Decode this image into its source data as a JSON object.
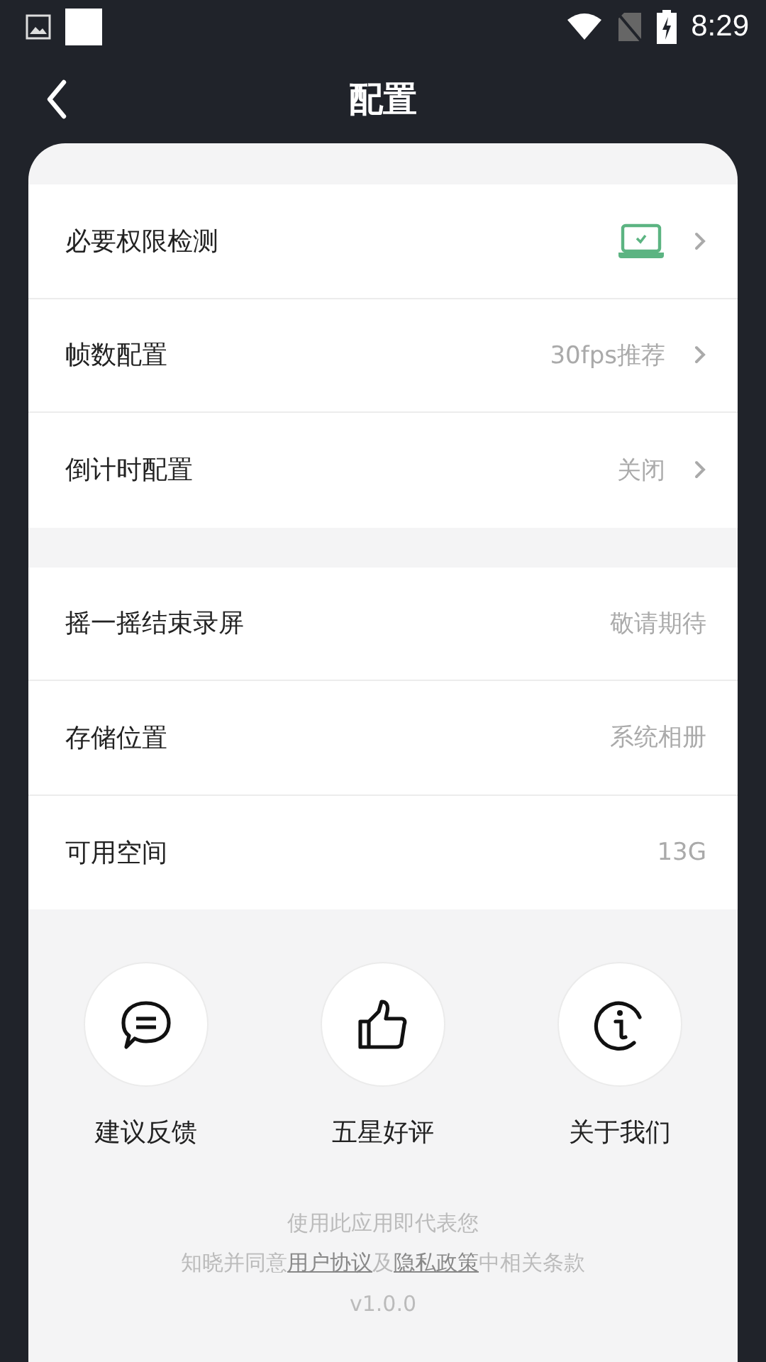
{
  "status_bar": {
    "time": "8:29"
  },
  "header": {
    "title": "配置"
  },
  "sections": [
    {
      "rows": [
        {
          "label": "必要权限检测",
          "kind": "status",
          "chevron": true
        },
        {
          "label": "帧数配置",
          "kind": "value",
          "value": "30fps推荐",
          "chevron": true
        },
        {
          "label": "倒计时配置",
          "kind": "value",
          "value": "关闭",
          "chevron": true
        }
      ]
    },
    {
      "rows": [
        {
          "label": "摇一摇结束录屏",
          "kind": "value",
          "value": "敬请期待",
          "chevron": false
        },
        {
          "label": "存储位置",
          "kind": "value",
          "value": "系统相册",
          "chevron": false
        },
        {
          "label": "可用空间",
          "kind": "value",
          "value": "13G",
          "chevron": false
        }
      ]
    }
  ],
  "actions": [
    {
      "label": "建议反馈",
      "kind": "feedback"
    },
    {
      "label": "五星好评",
      "kind": "rate"
    },
    {
      "label": "关于我们",
      "kind": "about"
    }
  ],
  "agreement": {
    "line_1": "使用此应用即代表您",
    "line_2": [
      {
        "text": "知晓并同意",
        "link": false
      },
      {
        "text": "用户协议",
        "link": true
      },
      {
        "text": "及",
        "link": false
      },
      {
        "text": "隐私政策",
        "link": true
      },
      {
        "text": "中相关条款",
        "link": false
      }
    ]
  },
  "version": "v1.0.0"
}
